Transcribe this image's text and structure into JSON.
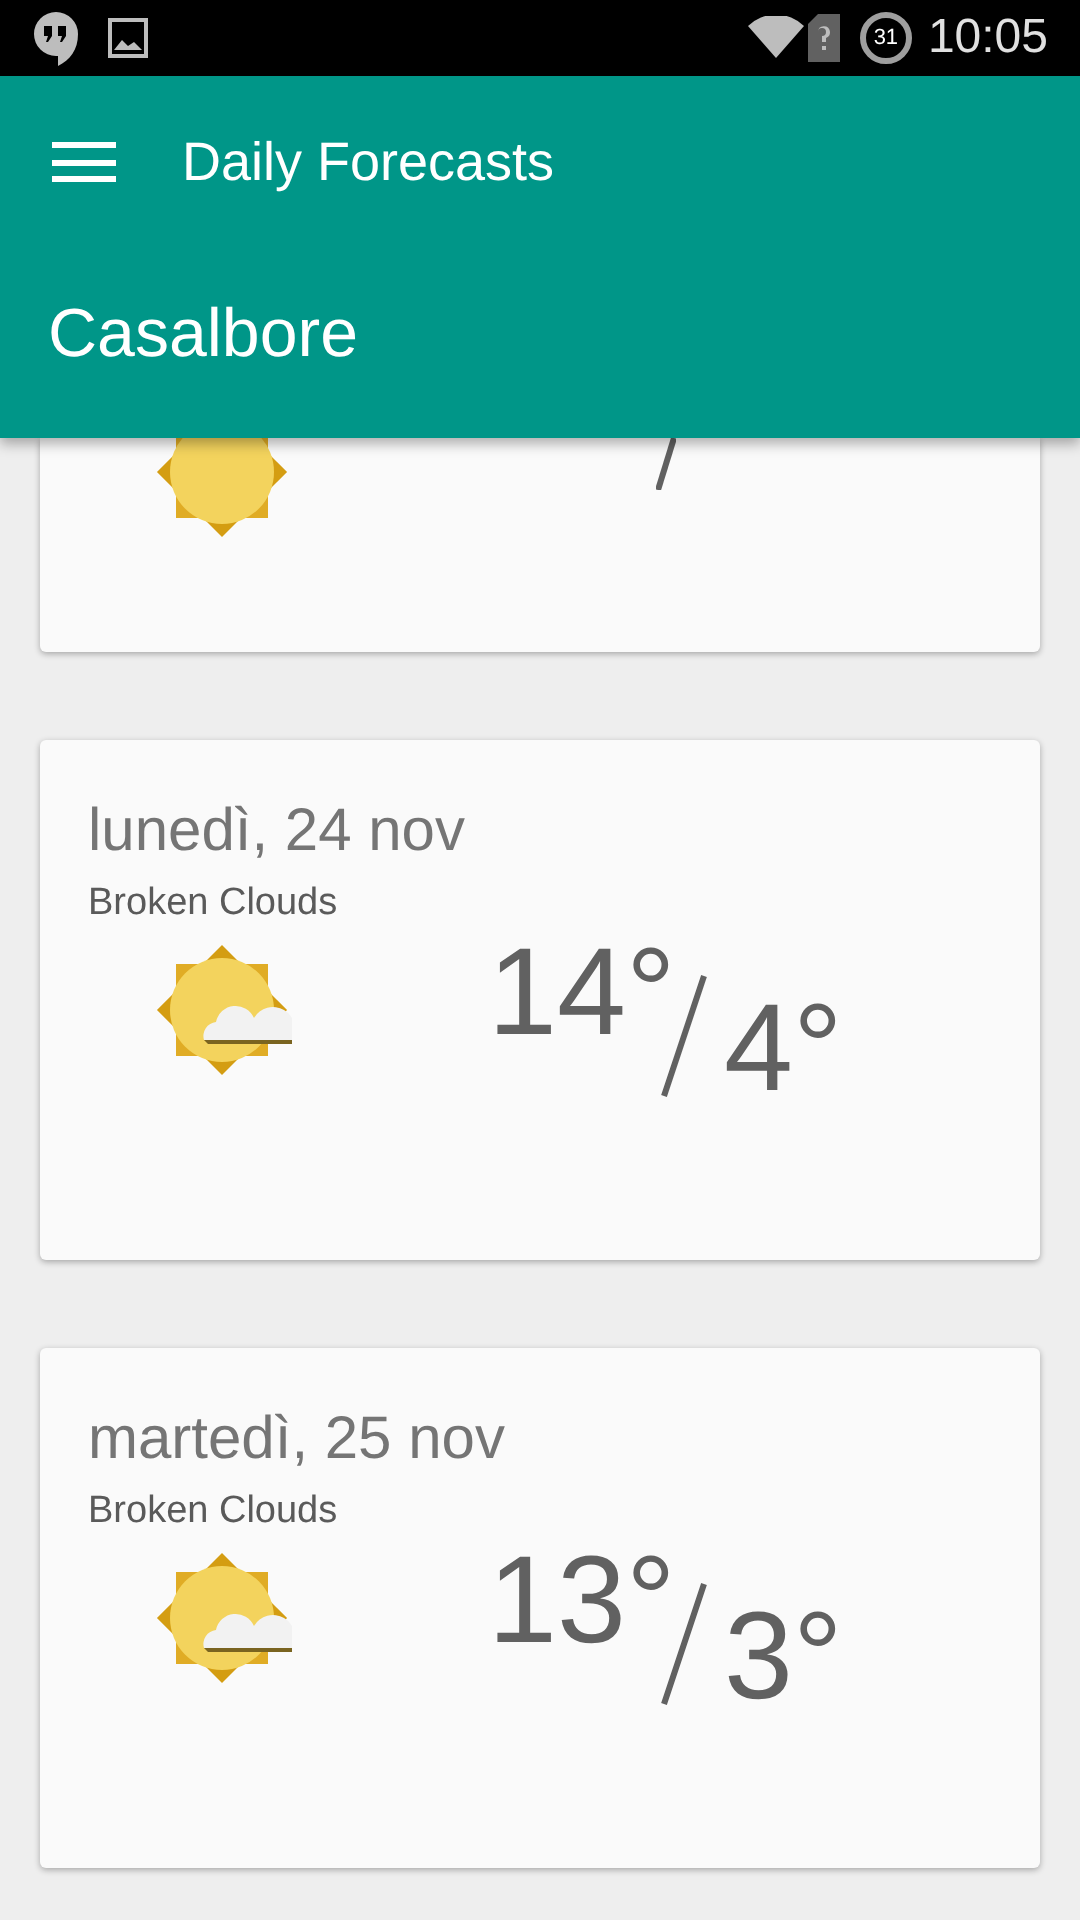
{
  "status_bar": {
    "calendar_badge": "31",
    "time": "10:05"
  },
  "app_bar": {
    "title": "Daily Forecasts",
    "location": "Casalbore"
  },
  "forecasts": [
    {
      "kind": "sun"
    },
    {
      "kind": "sun-cloud",
      "day": "lunedì, 24 nov",
      "description": "Broken Clouds",
      "high": "14°",
      "low": "4°"
    },
    {
      "kind": "sun-cloud",
      "day": "martedì, 25 nov",
      "description": "Broken Clouds",
      "high": "13°",
      "low": "3°"
    }
  ]
}
